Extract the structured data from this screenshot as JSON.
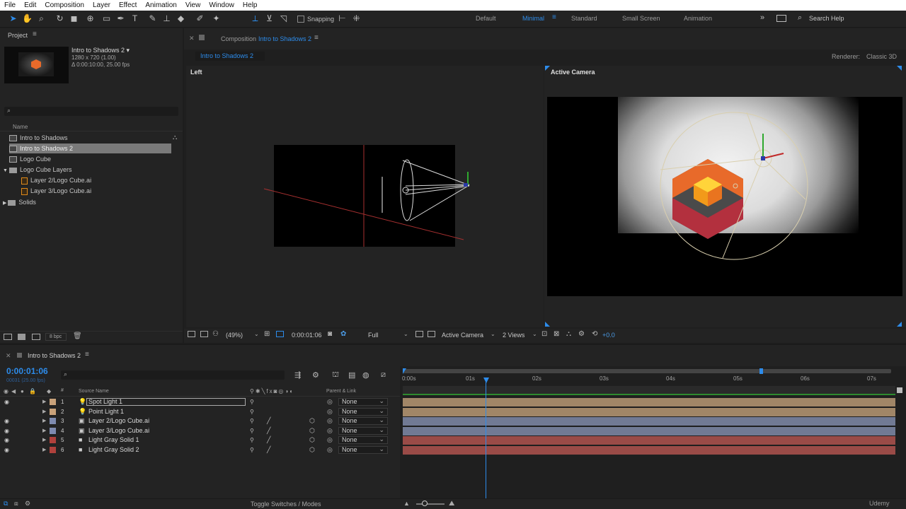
{
  "menu": [
    "File",
    "Edit",
    "Composition",
    "Layer",
    "Effect",
    "Animation",
    "View",
    "Window",
    "Help"
  ],
  "toolbar": {
    "snapping_label": "Snapping",
    "workspaces": [
      "Default",
      "Minimal",
      "Standard",
      "Small Screen",
      "Animation"
    ],
    "active_workspace": "Minimal",
    "search_placeholder": "Search Help"
  },
  "project": {
    "title": "Project",
    "comp_name": "Intro to Shadows 2 ▾",
    "comp_size": "1280 x 720 (1.00)",
    "comp_duration": "Δ 0:00:10:00, 25.00 fps",
    "search_placeholder": "",
    "col_name": "Name",
    "items": [
      {
        "label": "Intro to Shadows",
        "type": "comp"
      },
      {
        "label": "Intro to Shadows 2",
        "type": "comp"
      },
      {
        "label": "Logo Cube",
        "type": "comp"
      },
      {
        "label": "Logo Cube Layers",
        "type": "folder"
      },
      {
        "label": "Layer 2/Logo Cube.ai",
        "type": "ai"
      },
      {
        "label": "Layer 3/Logo Cube.ai",
        "type": "ai"
      },
      {
        "label": "Solids",
        "type": "folder"
      }
    ],
    "bpc": "8 bpc"
  },
  "composition": {
    "panel_label": "Composition",
    "comp_name": "Intro to Shadows 2",
    "tab": "Intro to Shadows 2",
    "renderer_label": "Renderer:",
    "renderer_value": "Classic 3D",
    "view_left": "Left",
    "view_right": "Active Camera",
    "zoom": "(49%)",
    "timecode": "0:00:01:06",
    "resolution": "Full",
    "camera": "Active Camera",
    "views": "2 Views",
    "exposure": "+0.0"
  },
  "timeline": {
    "tab": "Intro to Shadows 2",
    "timecode": "0:00:01:06",
    "frame_info": "00031 (25.00 fps)",
    "col_source": "Source Name",
    "col_parent": "Parent & Link",
    "layers": [
      {
        "num": "1",
        "name": "Spot Light 1",
        "color": "#c9a27a",
        "parent": "None",
        "type": "light",
        "bar": "#a18667"
      },
      {
        "num": "2",
        "name": "Point Light 1",
        "color": "#c9a27a",
        "parent": "None",
        "type": "light",
        "bar": "#a18667"
      },
      {
        "num": "3",
        "name": "Layer 2/Logo Cube.ai",
        "color": "#7e8bb0",
        "parent": "None",
        "type": "ai",
        "bar": "#717a94"
      },
      {
        "num": "4",
        "name": "Layer 3/Logo Cube.ai",
        "color": "#7e8bb0",
        "parent": "None",
        "type": "ai",
        "bar": "#717a94"
      },
      {
        "num": "5",
        "name": "Light Gray Solid 1",
        "color": "#b0413c",
        "parent": "None",
        "type": "solid",
        "bar": "#9a4b47"
      },
      {
        "num": "6",
        "name": "Light Gray Solid 2",
        "color": "#b0413c",
        "parent": "None",
        "type": "solid",
        "bar": "#9a4b47"
      }
    ],
    "ruler": [
      "0:00s",
      "01s",
      "02s",
      "03s",
      "04s",
      "05s",
      "06s",
      "07s"
    ],
    "footer_label": "Toggle Switches / Modes",
    "watermark": "Udemy"
  }
}
